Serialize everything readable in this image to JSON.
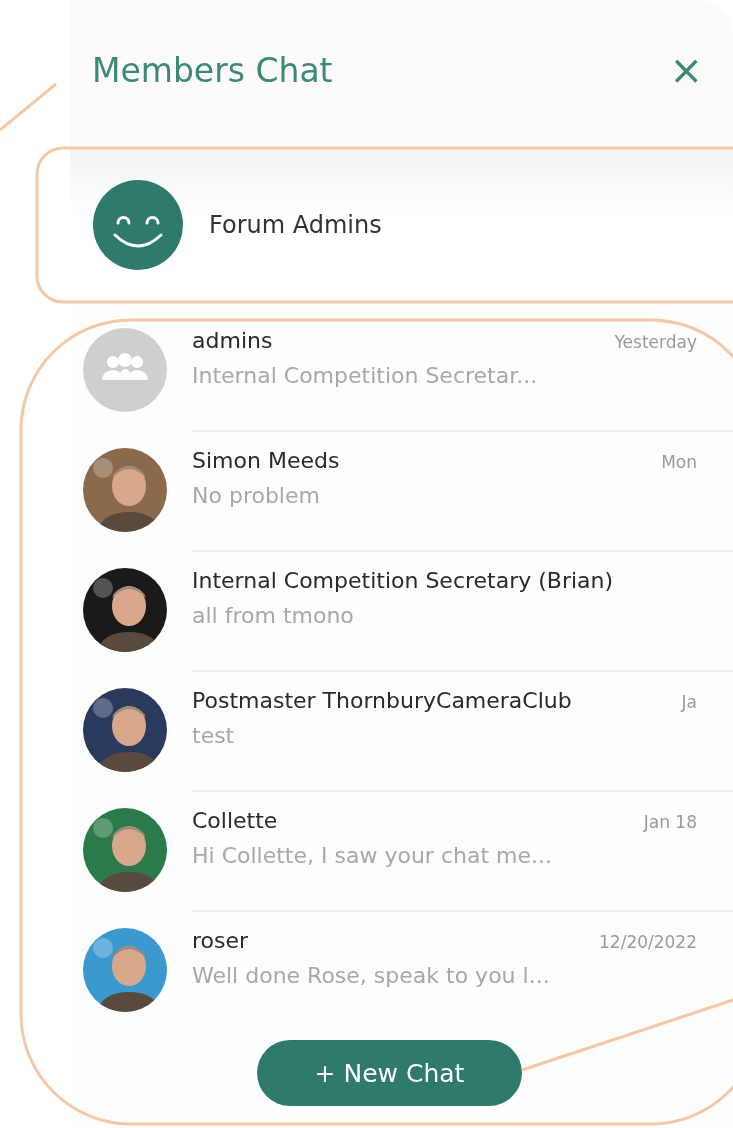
{
  "panel": {
    "title": "Members Chat",
    "close": "×"
  },
  "pinned": {
    "name": "Forum Admins",
    "avatar": {
      "kind": "smiley"
    }
  },
  "chats": [
    {
      "name": "admins",
      "date": "Yesterday",
      "preview": "Internal Competition Secretar...",
      "avatar": {
        "kind": "group"
      }
    },
    {
      "name": "Simon Meeds",
      "date": "Mon",
      "preview": "No problem"
    },
    {
      "name": "Internal Competition Secretary (Brian)",
      "preview": "all from tmono"
    },
    {
      "name": "Postmaster ThornburyCameraClub",
      "date": "Ja",
      "preview": "test"
    },
    {
      "name": "Collette",
      "date": "Jan 18",
      "preview": "Hi Collette, I saw your chat me..."
    },
    {
      "name": "roser",
      "date": "12/20/2022",
      "preview": "Well done Rose, speak to you l..."
    }
  ],
  "new_chat_button": "+ New Chat"
}
